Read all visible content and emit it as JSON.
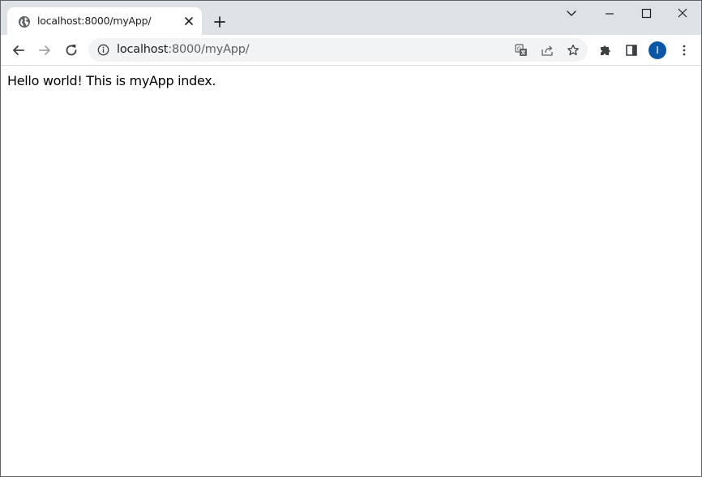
{
  "tab": {
    "title": "localhost:8000/myApp/"
  },
  "address_bar": {
    "host": "localhost",
    "path": ":8000/myApp/"
  },
  "profile": {
    "initial": "I",
    "color": "#0b57a6"
  },
  "icons": {
    "favicon": "globe-icon",
    "tab_close": "close-icon",
    "new_tab": "plus-icon",
    "tab_search": "chevron-down-icon",
    "minimize": "minimize-icon",
    "maximize": "maximize-icon",
    "close_window": "close-icon",
    "back": "arrow-left-icon",
    "forward": "arrow-right-icon",
    "reload": "reload-icon",
    "site_info": "info-icon",
    "translate": "translate-icon",
    "share": "share-icon",
    "bookmark": "star-icon",
    "extensions": "puzzle-icon",
    "side_panel": "side-panel-icon",
    "menu": "kebab-menu-icon"
  },
  "page": {
    "body_text": "Hello world! This is myApp index."
  }
}
